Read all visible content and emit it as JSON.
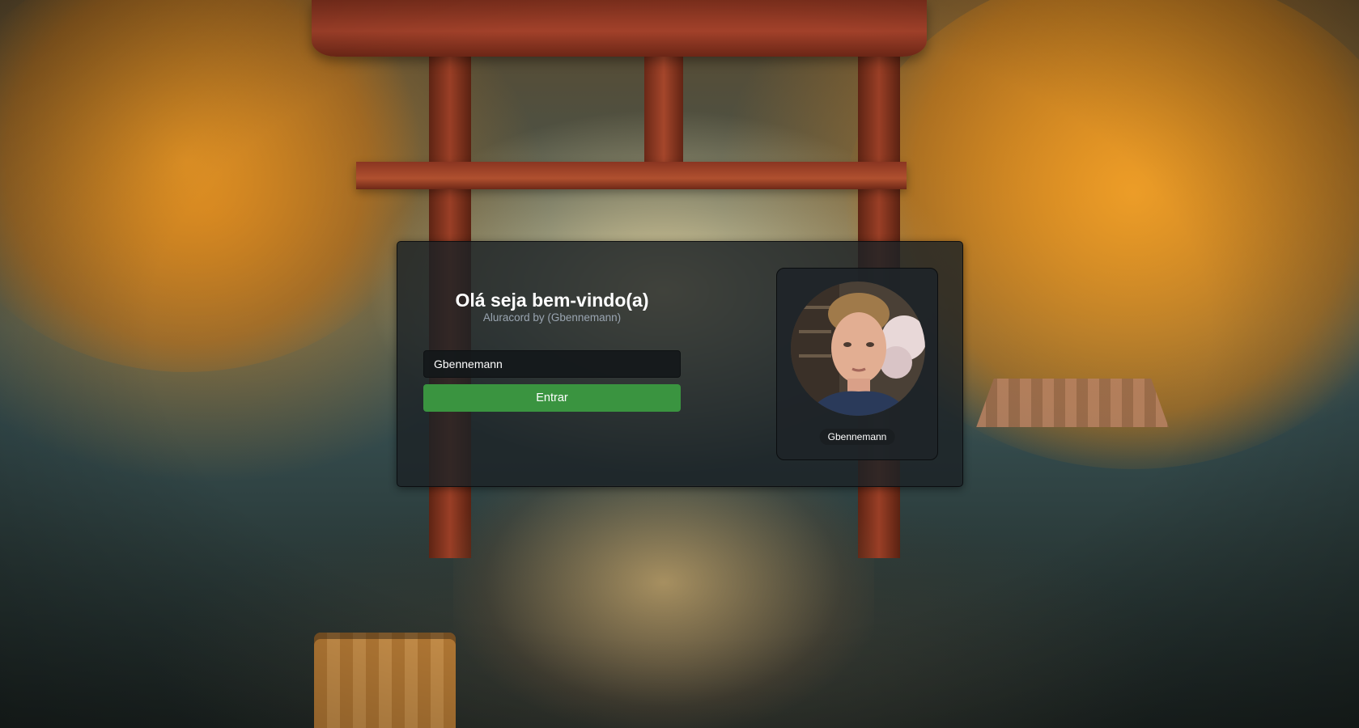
{
  "login": {
    "title": "Olá seja bem-vindo(a)",
    "subtitle": "Aluracord by (Gbennemann)",
    "username_value": "Gbennemann",
    "enter_label": "Entrar"
  },
  "profile": {
    "username": "Gbennemann"
  },
  "colors": {
    "button_green": "#3a9440",
    "panel_bg": "#1c2226"
  }
}
